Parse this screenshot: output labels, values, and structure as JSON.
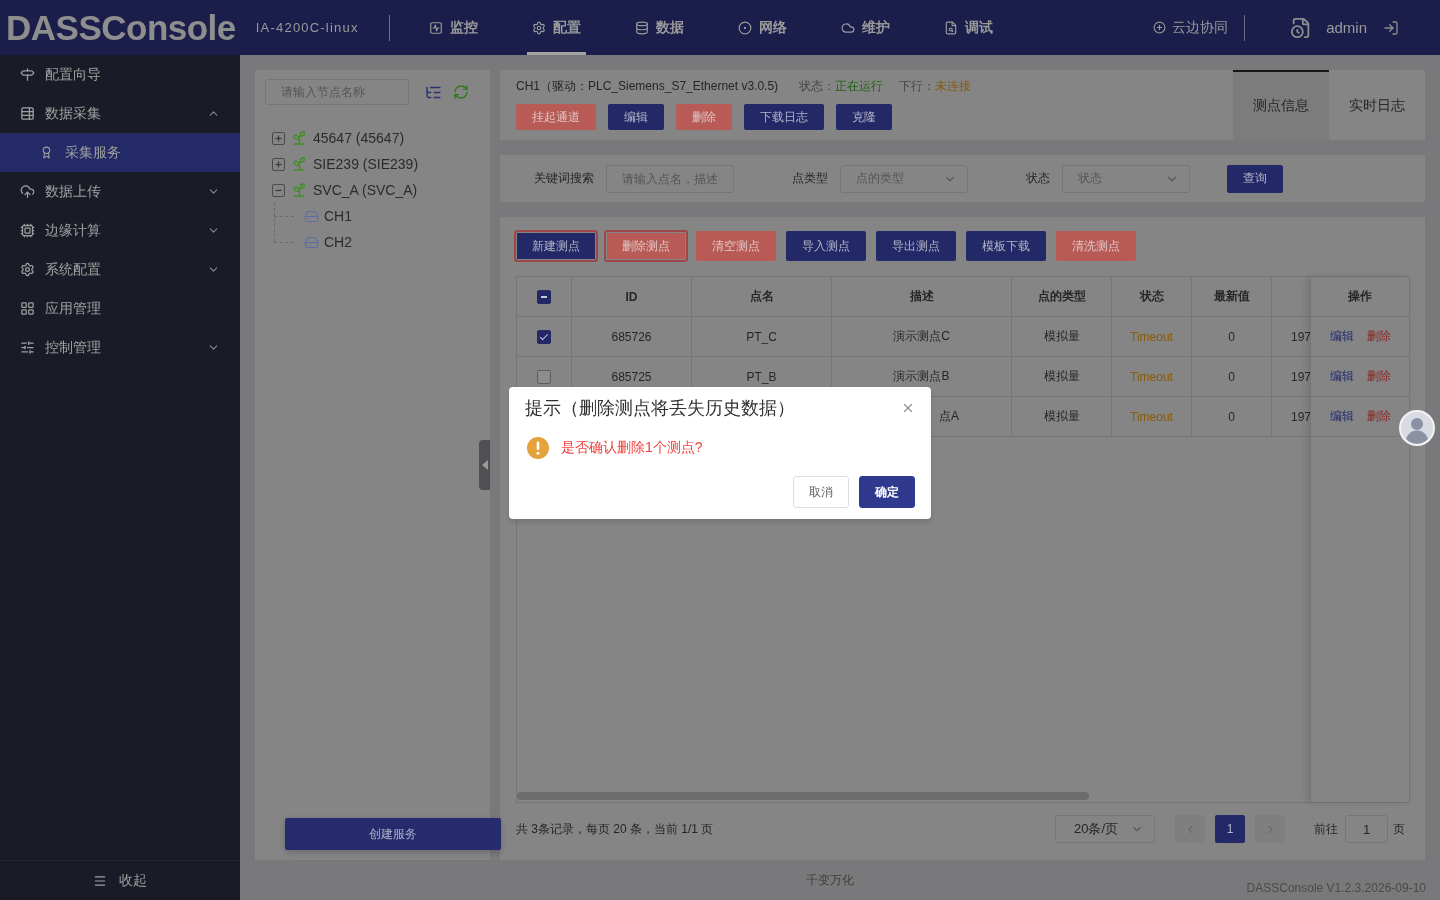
{
  "header": {
    "logo": "DASSConsole",
    "device": "IA-4200C-linux",
    "nav": [
      {
        "label": "监控",
        "selected": false
      },
      {
        "label": "配置",
        "selected": true
      },
      {
        "label": "数据",
        "selected": false
      },
      {
        "label": "网络",
        "selected": false
      },
      {
        "label": "维护",
        "selected": false
      },
      {
        "label": "调试",
        "selected": false
      }
    ],
    "cloud_sync": "云边协同",
    "user": "admin"
  },
  "sidebar": {
    "items": [
      {
        "label": "配置向导",
        "kind": "link",
        "selected": false
      },
      {
        "label": "数据采集",
        "kind": "group",
        "expanded": true,
        "selected": false,
        "children": [
          {
            "label": "采集服务",
            "selected": true
          }
        ]
      },
      {
        "label": "数据上传",
        "kind": "group",
        "expanded": false,
        "selected": false
      },
      {
        "label": "边缘计算",
        "kind": "group",
        "expanded": false,
        "selected": false
      },
      {
        "label": "系统配置",
        "kind": "group",
        "expanded": false,
        "selected": false
      },
      {
        "label": "应用管理",
        "kind": "link",
        "selected": false
      },
      {
        "label": "控制管理",
        "kind": "group",
        "expanded": false,
        "selected": false
      }
    ],
    "collapse": "收起"
  },
  "tree_panel": {
    "search": {
      "placeholder": "请输入节点名称"
    },
    "nodes": [
      {
        "label": "45647 (45647)",
        "expanded": false
      },
      {
        "label": "SIE239 (SIE239)",
        "expanded": false
      },
      {
        "label": "SVC_A (SVC_A)",
        "expanded": true,
        "children": [
          {
            "label": "CH1"
          },
          {
            "label": "CH2"
          }
        ]
      }
    ],
    "create_button": "创建服务"
  },
  "channel": {
    "title": "CH1（驱动：PLC_Siemens_S7_Ethernet v3.0.5)",
    "status_label": "状态：",
    "status": "正在运行",
    "downlink_label": "下行：",
    "downlink": "未连接",
    "buttons": [
      {
        "label": "挂起通道",
        "kind": "danger"
      },
      {
        "label": "编辑",
        "kind": "primary"
      },
      {
        "label": "删除",
        "kind": "danger"
      },
      {
        "label": "下载日志",
        "kind": "primary"
      },
      {
        "label": "克隆",
        "kind": "primary"
      }
    ]
  },
  "tabs": [
    {
      "label": "测点信息",
      "selected": true
    },
    {
      "label": "实时日志",
      "selected": false
    }
  ],
  "filter": {
    "fields": [
      {
        "label": "关键词搜索",
        "kind": "input",
        "placeholder": "请输入点名，描述"
      },
      {
        "label": "点类型",
        "kind": "select",
        "placeholder": "点的类型"
      },
      {
        "label": "状态",
        "kind": "select",
        "placeholder": "状态"
      }
    ],
    "button": "查询"
  },
  "toolbar": [
    {
      "label": "新建测点",
      "kind": "primary",
      "highlighted": true
    },
    {
      "label": "删除测点",
      "kind": "danger",
      "highlighted": true
    },
    {
      "label": "清空测点",
      "kind": "danger",
      "highlighted": false
    },
    {
      "label": "导入测点",
      "kind": "primary",
      "highlighted": false
    },
    {
      "label": "导出测点",
      "kind": "primary",
      "highlighted": false
    },
    {
      "label": "模板下载",
      "kind": "primary",
      "highlighted": false
    },
    {
      "label": "清洗测点",
      "kind": "danger",
      "highlighted": false
    }
  ],
  "table": {
    "select_all": {
      "indeterminate": true
    },
    "columns": [
      "ID",
      "点名",
      "描述",
      "点的类型",
      "状态",
      "最新值"
    ],
    "action_column": "操作",
    "rows": [
      {
        "checked": true,
        "covered": false,
        "id": "685726",
        "name": "PT_C",
        "description": "演示测点C",
        "type": "模拟量",
        "status": "Timeout",
        "value": "0",
        "column_8": "197",
        "actions": [
          {
            "label": "编辑",
            "kind": "edit"
          },
          {
            "label": "删除",
            "kind": "delete"
          }
        ]
      },
      {
        "checked": false,
        "covered": false,
        "id": "685725",
        "name": "PT_B",
        "description": "演示测点B",
        "type": "模拟量",
        "status": "Timeout",
        "value": "0",
        "column_8": "197",
        "actions": [
          {
            "label": "编辑",
            "kind": "edit"
          },
          {
            "label": "删除",
            "kind": "delete"
          }
        ]
      },
      {
        "covered": true,
        "description": "点A",
        "type": "模拟量",
        "status": "Timeout",
        "value": "0",
        "column_8": "197",
        "actions": [
          {
            "label": "编辑",
            "kind": "edit"
          },
          {
            "label": "删除",
            "kind": "delete"
          }
        ]
      }
    ]
  },
  "pagination": {
    "summary": "共 3条记录，每页 20 条，当前 1/1 页",
    "page_size": "20条/页",
    "prev": {
      "disabled": true
    },
    "pages": [
      {
        "label": "1",
        "selected": true
      }
    ],
    "next": {
      "disabled": true
    },
    "goto_label": "前往",
    "goto_value": "1",
    "goto_suffix": "页"
  },
  "footer": {
    "slogan": "千变万化",
    "version": "DASSConsole V1.2.3.2026-09-10"
  },
  "dialog": {
    "title": "提示（删除测点将丢失历史数据）",
    "message": "是否确认删除1个测点?",
    "buttons": [
      {
        "label": "取消",
        "kind": "default"
      },
      {
        "label": "确定",
        "kind": "primary"
      }
    ]
  }
}
